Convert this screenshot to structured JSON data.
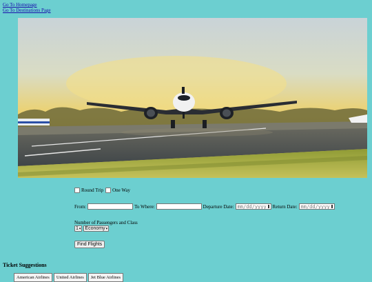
{
  "nav": {
    "home_link": "Go To Homepage",
    "destinations_link": "Go To Destinations Page"
  },
  "hero": {
    "alt": "Airplane on runway at sunset",
    "colors": {
      "sky_top": "#cfd6db",
      "sky_glow": "#e9d27a",
      "runway": "#4e5457",
      "grass": "#a8b54a"
    }
  },
  "form": {
    "trip_type": {
      "round_trip_label": "Round Trip",
      "one_way_label": "One Way"
    },
    "from_label": "From:",
    "to_label": "To Where:",
    "departure_label": "Departure Date:",
    "departure_placeholder": "mm/dd/yyyy",
    "return_label": "Return Date:",
    "return_placeholder": "mm/dd/yyyy",
    "passengers_label": "Number of Passengers and Class",
    "passengers_value": "1",
    "class_value": "Economy",
    "find_button": "Find Flights"
  },
  "suggestions": {
    "title": "Ticket Suggestions",
    "airlines": [
      "American Airlines",
      "United Airlines",
      "Jet Blue Airlines"
    ]
  }
}
